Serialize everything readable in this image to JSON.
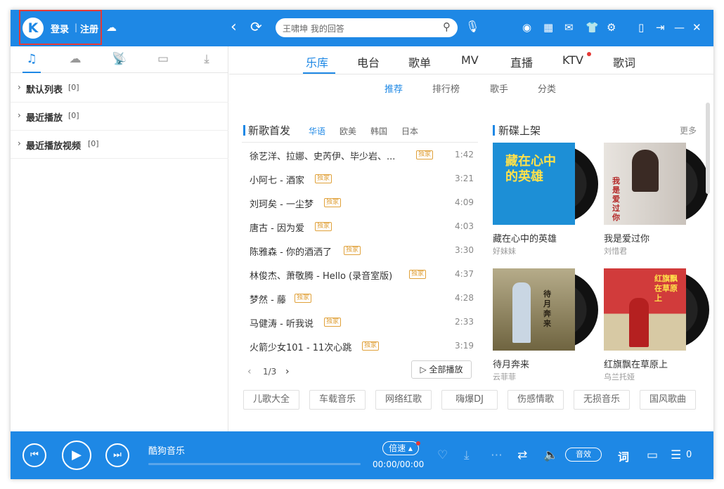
{
  "header": {
    "logo": "K",
    "login": "登录",
    "separator": "|",
    "register": "注册",
    "search_placeholder": "王啸坤 我的回答"
  },
  "left": {
    "playlists": [
      {
        "name": "默认列表",
        "count": "[0]"
      },
      {
        "name": "最近播放",
        "count": "[0]"
      },
      {
        "name": "最近播放视频",
        "count": "[0]"
      }
    ]
  },
  "main_tabs": [
    "乐库",
    "电台",
    "歌单",
    "MV",
    "直播",
    "KTV",
    "歌词"
  ],
  "sub_tabs": [
    "推荐",
    "排行榜",
    "歌手",
    "分类"
  ],
  "new_songs": {
    "title": "新歌首发",
    "regions": [
      "华语",
      "欧美",
      "韩国",
      "日本"
    ],
    "badge_label": "独家",
    "songs": [
      {
        "title": "徐艺洋、拉娜、史芮伊、毕少岩、...",
        "duration": "1:42"
      },
      {
        "title": "小阿七 - 酒家",
        "duration": "3:21"
      },
      {
        "title": "刘珂矣 - 一尘梦",
        "duration": "4:09"
      },
      {
        "title": "唐古 - 因为爱",
        "duration": "4:03"
      },
      {
        "title": "陈雅森 - 你的酒洒了",
        "duration": "3:30"
      },
      {
        "title": "林俊杰、萧敬腾 - Hello (录音室版)",
        "duration": "4:37"
      },
      {
        "title": "梦然 - 藤",
        "duration": "4:28"
      },
      {
        "title": "马健涛 - 听我说",
        "duration": "2:33"
      },
      {
        "title": "火箭少女101 - 11次心跳",
        "duration": "3:19"
      }
    ],
    "pager": "1/3",
    "play_all": "全部播放"
  },
  "new_albums": {
    "title": "新碟上架",
    "more": "更多",
    "albums": [
      {
        "title": "藏在心中的英雄",
        "artist": "好妹妹",
        "cover_color": "#1d8fd6",
        "cover_text": "藏在心中的英雄"
      },
      {
        "title": "我是爱过你",
        "artist": "刘惜君",
        "cover_color": "#d9d4cf",
        "cover_text": "我是爱过你"
      },
      {
        "title": "待月奔来",
        "artist": "云菲菲",
        "cover_color": "#8a7d58",
        "cover_text": "待月奔来"
      },
      {
        "title": "红旗飘在草原上",
        "artist": "乌兰托娅",
        "cover_color": "#c92c2c",
        "cover_text": "红旗飘在草原上"
      }
    ]
  },
  "tags": [
    "儿歌大全",
    "车载音乐",
    "网络红歌",
    "嗨爆DJ",
    "伤感情歌",
    "无损音乐",
    "国风歌曲"
  ],
  "player": {
    "title": "酷狗音乐",
    "speed": "倍速",
    "time": "00:00/00:00",
    "effect": "音效",
    "lyric": "词",
    "queue_count": "0"
  },
  "colors": {
    "accent": "#1e88e5",
    "badge": "#e0a13a",
    "alert_dot": "#e53935"
  }
}
